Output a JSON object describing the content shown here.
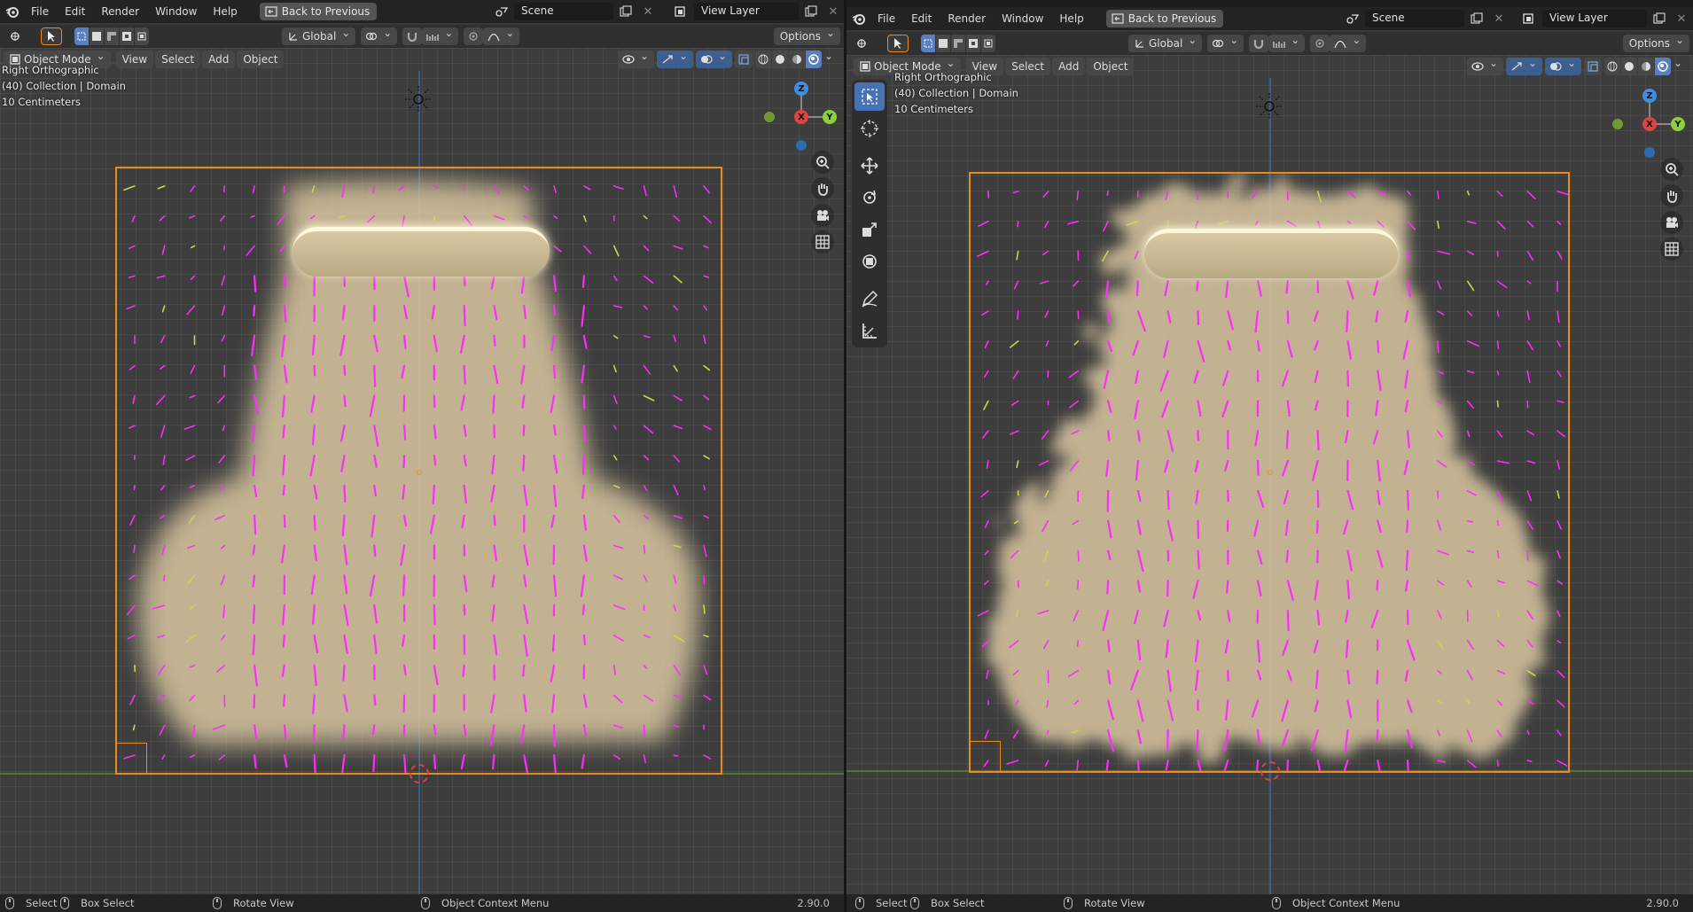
{
  "app": "Blender",
  "panes": [
    {
      "menu": [
        "File",
        "Edit",
        "Render",
        "Window",
        "Help"
      ],
      "back_button": "Back to Previous",
      "scene": "Scene",
      "view_layer": "View Layer",
      "transform_orientation": "Global",
      "options_label": "Options",
      "mode": "Object Mode",
      "viewport_menu": [
        "View",
        "Select",
        "Add",
        "Object"
      ],
      "overlay": {
        "view_name": "Right Orthographic",
        "collection": "(40) Collection | Domain",
        "scale": "10 Centimeters"
      },
      "gizmo_axes": {
        "z": "Z",
        "x": "X",
        "y": "Y"
      },
      "statusbar": {
        "select": "Select",
        "box_select": "Box Select",
        "rotate_view": "Rotate View",
        "context_menu": "Object Context Menu",
        "version": "2.90.0"
      }
    },
    {
      "menu": [
        "File",
        "Edit",
        "Render",
        "Window",
        "Help"
      ],
      "back_button": "Back to Previous",
      "scene": "Scene",
      "view_layer": "View Layer",
      "transform_orientation": "Global",
      "options_label": "Options",
      "mode": "Object Mode",
      "viewport_menu": [
        "View",
        "Select",
        "Add",
        "Object"
      ],
      "overlay": {
        "view_name": "Right Orthographic",
        "collection": "(40) Collection | Domain",
        "scale": "10 Centimeters"
      },
      "gizmo_axes": {
        "z": "Z",
        "x": "X",
        "y": "Y"
      },
      "statusbar": {
        "select": "Select",
        "box_select": "Box Select",
        "rotate_view": "Rotate View",
        "context_menu": "Object Context Menu",
        "version": "2.90.0"
      }
    }
  ],
  "colors": {
    "domain_outline": "#e98b1c",
    "velocity_vectors": "#ff2bff",
    "smoke": "#d9c7a0",
    "x_axis": "#e04242",
    "y_axis": "#8bd13a",
    "z_axis": "#3d8fe6"
  }
}
